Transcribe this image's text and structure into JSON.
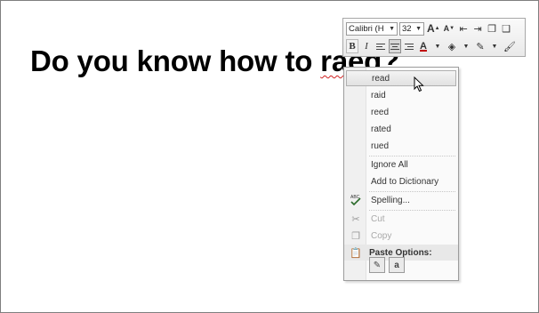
{
  "slide": {
    "text_before": "Do you know how to ",
    "misspelled_word": "raed",
    "text_after": "?"
  },
  "mini_toolbar": {
    "font_name": "Calibri (H",
    "font_size": "32",
    "grow_font": "A",
    "shrink_font": "A",
    "bold": "B",
    "italic": "I"
  },
  "context_menu": {
    "suggestions": [
      "read",
      "raid",
      "reed",
      "rated",
      "rued"
    ],
    "ignore_all": "Ignore All",
    "add_to_dictionary": "Add to Dictionary",
    "spelling": "Spelling...",
    "cut": "Cut",
    "copy": "Copy",
    "paste_options_header": "Paste Options:"
  }
}
